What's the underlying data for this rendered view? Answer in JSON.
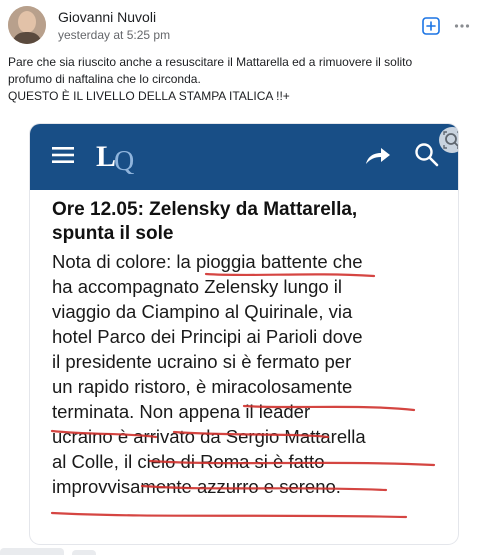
{
  "post": {
    "author": "Giovanni Nuvoli",
    "timestamp": "yesterday at 5:25 pm",
    "text_lines": [
      "Pare che sia riuscito anche a resuscitare il Mattarella ed a rimuovere il solito",
      "profumo di naftalina che lo circonda.",
      "QUESTO È IL LIVELLO DELLA STAMPA ITALICA !!+"
    ],
    "icons": {
      "add": "plus-square-icon",
      "more": "more-dots-icon"
    }
  },
  "screenshot": {
    "app_bar": {
      "logo_text": "LQ",
      "icons": [
        "menu-icon",
        "share-arrow-icon",
        "search-icon",
        "visual-search-icon"
      ],
      "color": "#184e86"
    },
    "headline_lines": [
      "Ore 12.05: Zelensky da Mattarella,",
      "spunta il sole"
    ],
    "body_lines": [
      "Nota di colore: la pioggia battente che",
      "ha accompagnato Zelensky lungo il",
      "viaggio da Ciampino al Quirinale, via",
      "hotel Parco dei Principi ai Parioli dove",
      "il presidente ucraino si è fermato per",
      "un rapido ristoro, è miracolosamente",
      "terminata. Non appena il leader",
      "ucraino è arrivato da Sergio Mattarella",
      "al Colle, il cielo di Roma si è fatto",
      "improvvisamente azzurro e sereno."
    ],
    "underline_color": "#d0312d"
  }
}
